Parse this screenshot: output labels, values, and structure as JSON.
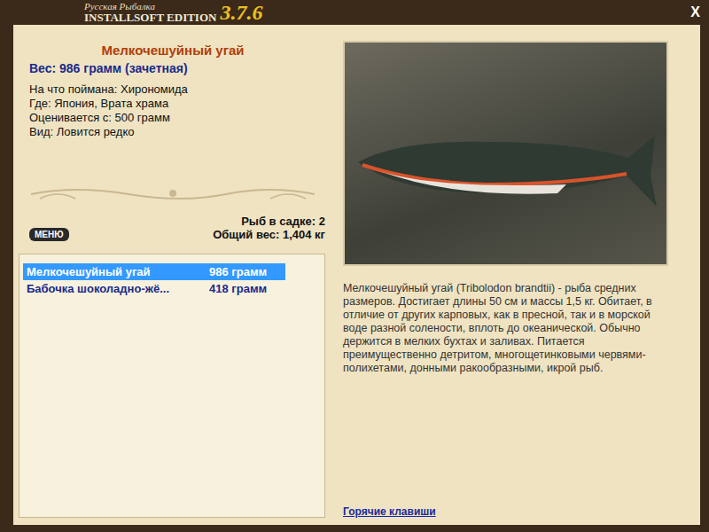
{
  "logo": {
    "title": "Русская Рыбалка",
    "edition": "INSTALLSOFT EDITION",
    "version": "3.7.6"
  },
  "close_button": "X",
  "fish": {
    "name": "Мелкочешуйный угай",
    "weight": "Вес: 986 грамм (зачетная)",
    "details": [
      "На что поймана: Хирономида",
      "Где: Япония, Врата храма",
      "Оценивается с: 500 грамм",
      "Вид: Ловится редко"
    ]
  },
  "menu_button": "МЕНЮ",
  "keepnet": {
    "count": "Рыб в садке: 2",
    "total": "Общий вес: 1,404 кг"
  },
  "catch_list": [
    {
      "name": "Мелкочешуйный угай",
      "weight": "986 грамм",
      "selected": true
    },
    {
      "name": "Бабочка шоколадно-жё...",
      "weight": "418 грамм",
      "selected": false
    }
  ],
  "description": "Мелкочешуйный угай (Tribolodon brandtii) - рыба средних размеров. Достигает длины 50 см и массы 1,5 кг. Обитает, в отличие от других карповых, как в пресной, так и в морской воде разной солености, вплоть до океанической. Обычно держится в мелких бухтах и заливах. Питается преимущественно детритом, многощетинковыми червями-полихетами, донными ракообразными, икрой рыб.",
  "hotkeys_link": "Горячие клавиши"
}
